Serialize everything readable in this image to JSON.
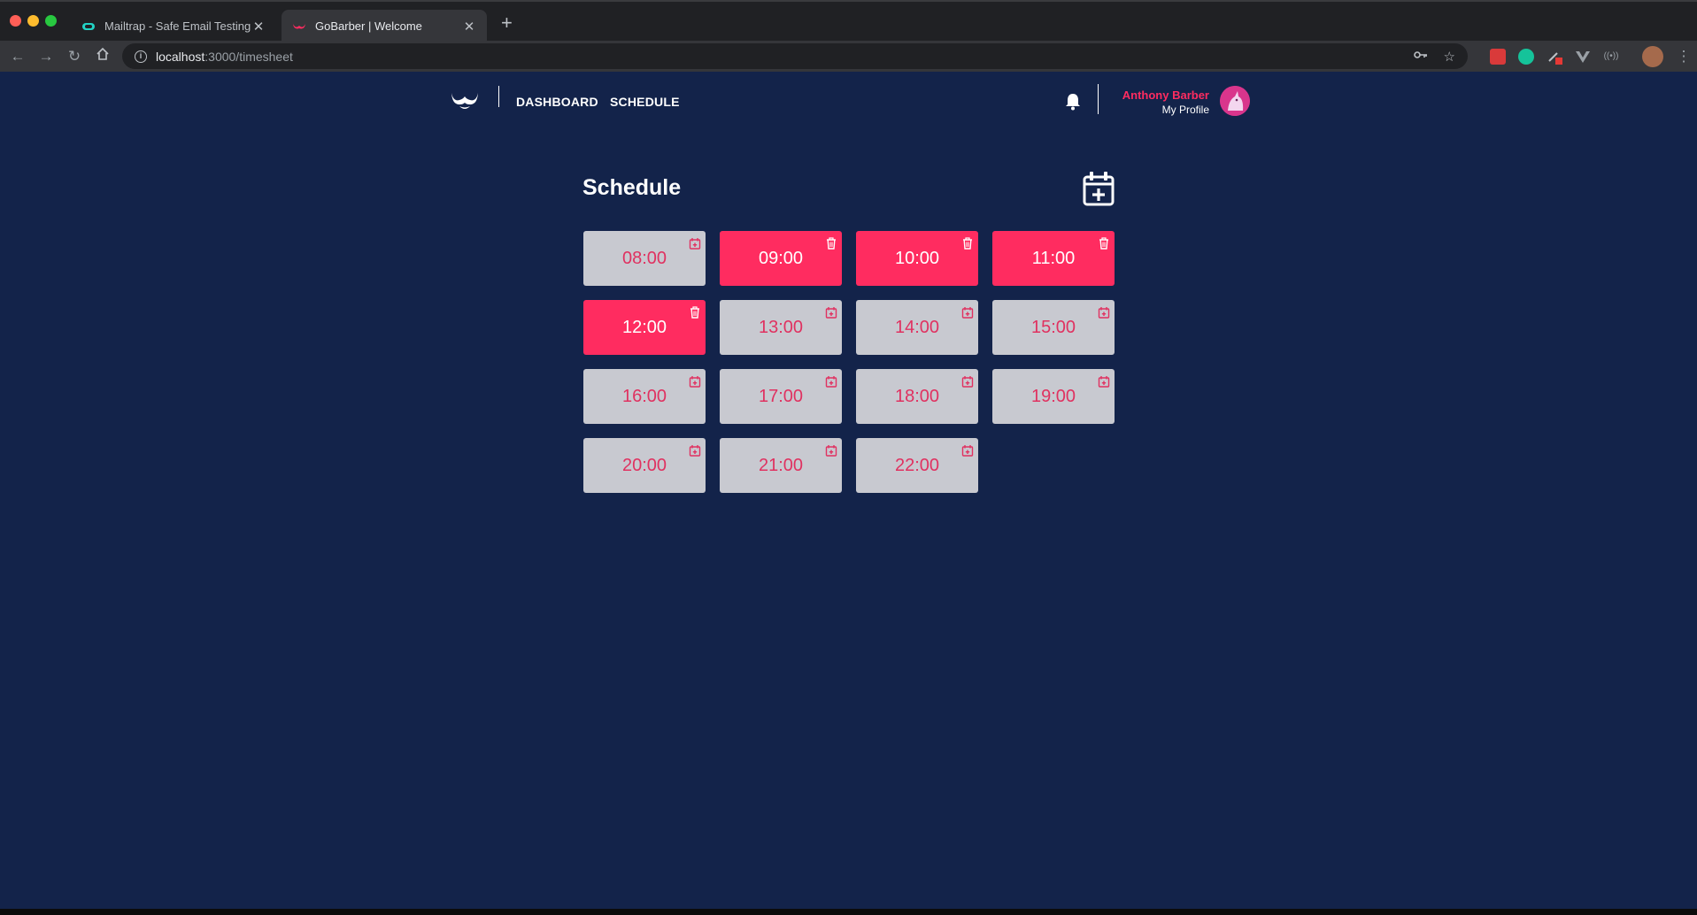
{
  "browser": {
    "tabs": [
      {
        "title": "Mailtrap - Safe Email Testing",
        "active": false,
        "icon": "mailtrap-icon"
      },
      {
        "title": "GoBarber | Welcome",
        "active": true,
        "icon": "gobarber-icon"
      }
    ],
    "address": {
      "host": "localhost",
      "path": ":3000/timesheet"
    }
  },
  "header": {
    "nav": [
      {
        "label": "DASHBOARD"
      },
      {
        "label": "SCHEDULE"
      }
    ],
    "profile": {
      "name": "Anthony Barber",
      "link": "My Profile"
    }
  },
  "page": {
    "title": "Schedule"
  },
  "slots": [
    {
      "time": "08:00",
      "booked": false
    },
    {
      "time": "09:00",
      "booked": true
    },
    {
      "time": "10:00",
      "booked": true
    },
    {
      "time": "11:00",
      "booked": true
    },
    {
      "time": "12:00",
      "booked": true
    },
    {
      "time": "13:00",
      "booked": false
    },
    {
      "time": "14:00",
      "booked": false
    },
    {
      "time": "15:00",
      "booked": false
    },
    {
      "time": "16:00",
      "booked": false
    },
    {
      "time": "17:00",
      "booked": false
    },
    {
      "time": "18:00",
      "booked": false
    },
    {
      "time": "19:00",
      "booked": false
    },
    {
      "time": "20:00",
      "booked": false
    },
    {
      "time": "21:00",
      "booked": false
    },
    {
      "time": "22:00",
      "booked": false
    }
  ],
  "colors": {
    "background": "#13234a",
    "accent": "#ff2c60",
    "free_slot": "#c8c9d0"
  }
}
